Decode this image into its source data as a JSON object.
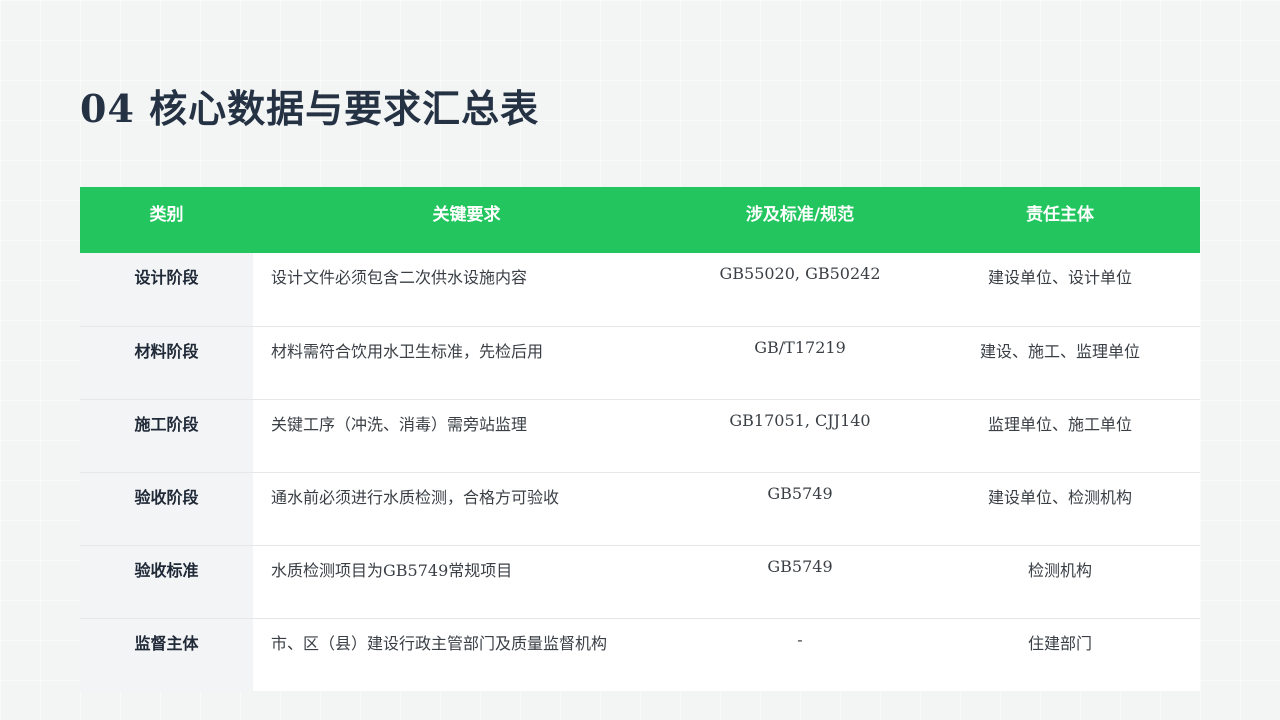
{
  "page": {
    "title": "04 核心数据与要求汇总表"
  },
  "table": {
    "headers": [
      "类别",
      "关键要求",
      "涉及标准/规范",
      "责任主体"
    ],
    "rows": [
      {
        "category": "设计阶段",
        "requirement": "设计文件必须包含二次供水设施内容",
        "standard": "GB55020, GB50242",
        "owner": "建设单位、设计单位"
      },
      {
        "category": "材料阶段",
        "requirement": "材料需符合饮用水卫生标准，先检后用",
        "standard": "GB/T17219",
        "owner": "建设、施工、监理单位"
      },
      {
        "category": "施工阶段",
        "requirement": "关键工序（冲洗、消毒）需旁站监理",
        "standard": "GB17051, CJJ140",
        "owner": "监理单位、施工单位"
      },
      {
        "category": "验收阶段",
        "requirement": "通水前必须进行水质检测，合格方可验收",
        "standard": "GB5749",
        "owner": "建设单位、检测机构"
      },
      {
        "category": "验收标准",
        "requirement": "水质检测项目为GB5749常规项目",
        "standard": "GB5749",
        "owner": "检测机构"
      },
      {
        "category": "监督主体",
        "requirement": "市、区（县）建设行政主管部门及质量监督机构",
        "standard": "-",
        "owner": "住建部门"
      }
    ]
  },
  "colors": {
    "header_bg": "#22c55e",
    "title": "#253244",
    "category_bg": "#f3f4f6"
  }
}
